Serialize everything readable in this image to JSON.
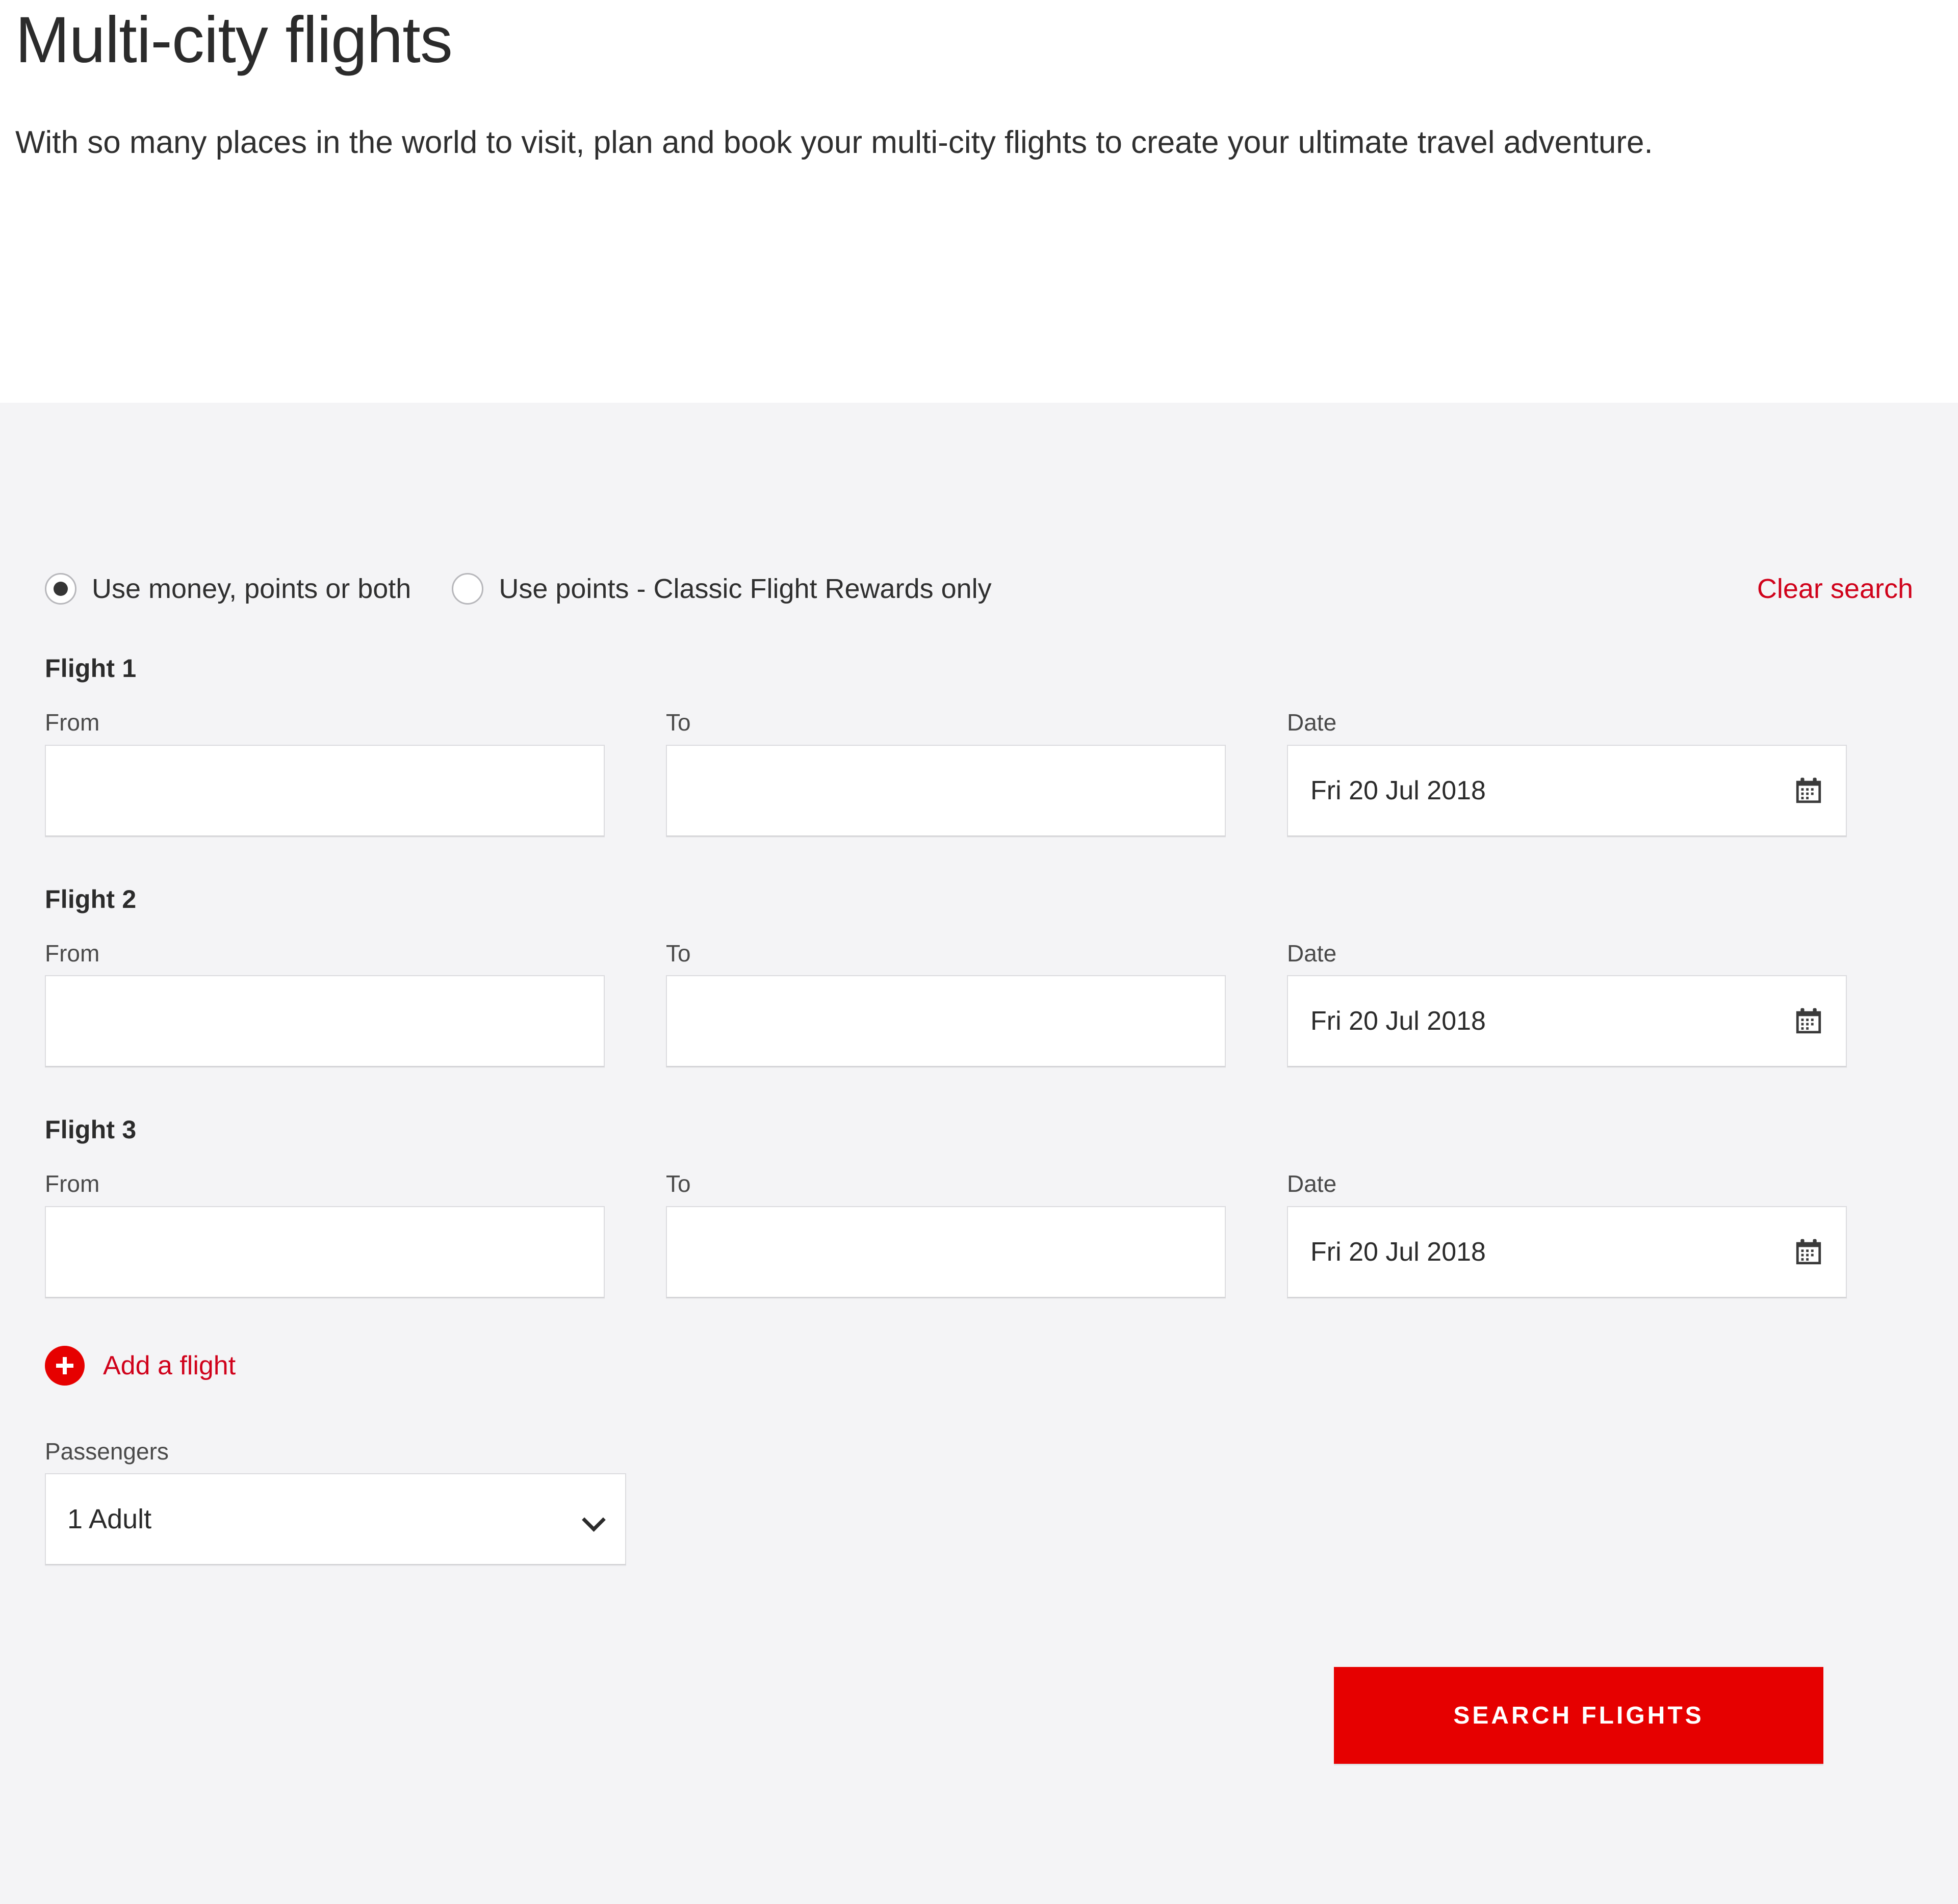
{
  "hero": {
    "title": "Multi-city flights",
    "subtitle": "With so many places in the world to visit, plan and book your multi-city flights to create your ultimate travel adventure."
  },
  "search_form": {
    "fare_options": [
      {
        "label": "Use money, points or both",
        "selected": true
      },
      {
        "label": "Use points - Classic Flight Rewards only",
        "selected": false
      }
    ],
    "clear_search_label": "Clear search",
    "field_labels": {
      "from": "From",
      "to": "To",
      "date": "Date"
    },
    "flights": [
      {
        "heading": "Flight 1",
        "from_value": "",
        "to_value": "",
        "date_value": "Fri 20 Jul 2018",
        "removable": false
      },
      {
        "heading": "Flight 2",
        "from_value": "",
        "to_value": "",
        "date_value": "Fri 20 Jul 2018",
        "removable": true
      },
      {
        "heading": "Flight 3",
        "from_value": "",
        "to_value": "",
        "date_value": "Fri 20 Jul 2018",
        "removable": true
      }
    ],
    "add_flight_label": "Add a flight",
    "passengers": {
      "label": "Passengers",
      "value": "1 Adult"
    },
    "submit_label": "Search flights"
  },
  "icons": {
    "calendar": "calendar-icon",
    "remove": "close-icon",
    "add": "plus-icon",
    "chevron": "chevron-down-icon"
  },
  "colors": {
    "brand_red": "#e60000",
    "link_red": "#d0021b",
    "panel_bg": "#f4f4f6",
    "text": "#2b2b2b"
  }
}
